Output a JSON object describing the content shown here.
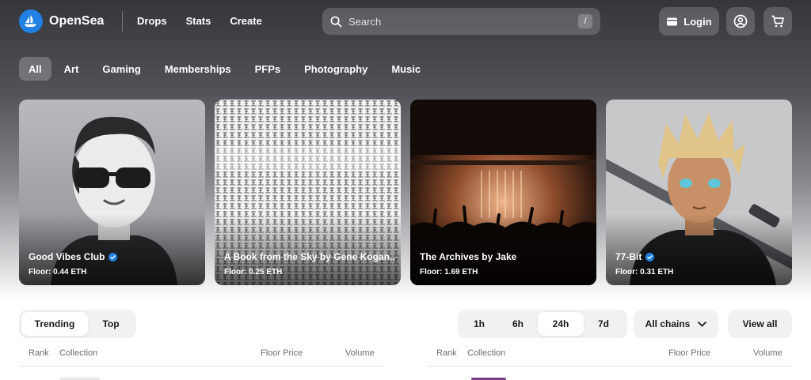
{
  "header": {
    "brand": "OpenSea",
    "nav_links": [
      "Drops",
      "Stats",
      "Create"
    ],
    "search": {
      "placeholder": "Search",
      "shortcut": "/"
    },
    "login_label": "Login",
    "icons": [
      "user-circle-icon",
      "cart-icon"
    ]
  },
  "categories": [
    "All",
    "Art",
    "Gaming",
    "Memberships",
    "PFPs",
    "Photography",
    "Music"
  ],
  "active_category": "All",
  "featured": [
    {
      "title": "Good Vibes Club",
      "verified": true,
      "floor": "Floor: 0.44 ETH"
    },
    {
      "title": "A Book from the Sky by Gene Kogan...",
      "verified": false,
      "floor": "Floor: 0.25 ETH"
    },
    {
      "title": "The Archives by Jake",
      "verified": false,
      "floor": "Floor: 1.69 ETH"
    },
    {
      "title": "77-Bit",
      "verified": true,
      "floor": "Floor: 0.31 ETH"
    }
  ],
  "ranking": {
    "tabs": [
      "Trending",
      "Top"
    ],
    "active_tab": "Trending",
    "time_ranges": [
      "1h",
      "6h",
      "24h",
      "7d"
    ],
    "active_range": "24h",
    "chain_filter": "All chains",
    "view_all": "View all",
    "columns": [
      "Rank",
      "Collection",
      "Floor Price",
      "Volume"
    ]
  },
  "colors": {
    "brand_blue": "#2081e2",
    "verified_blue": "#2081e2"
  }
}
